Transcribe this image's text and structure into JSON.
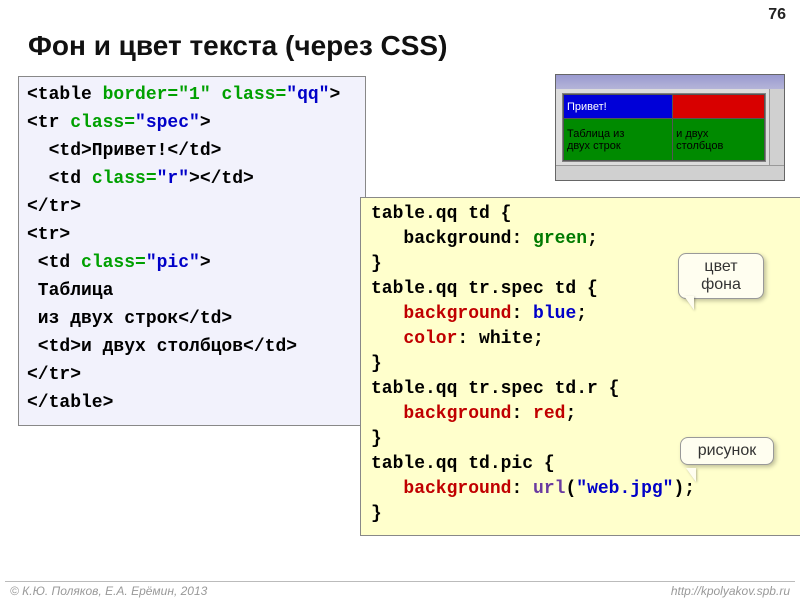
{
  "page_number": "76",
  "title": "Фон и цвет текста (через CSS)",
  "html_code": {
    "l1a": "<table ",
    "l1b": "border=\"1\"",
    "l1c": " class=",
    "l1d": "\"qq\"",
    "l1e": ">",
    "l2a": "<tr ",
    "l2b": "class=",
    "l2c": "\"spec\"",
    "l2d": ">",
    "l3": "  <td>Привет!</td>",
    "l4a": "  <td ",
    "l4b": "class=",
    "l4c": "\"r\"",
    "l4d": "></td>",
    "l5": "</tr>",
    "l6": "<tr>",
    "l7a": " <td ",
    "l7b": "class=",
    "l7c": "\"pic\"",
    "l7d": ">",
    "l8": " Таблица",
    "l9": " из двух строк</td>",
    "l10": " <td>и двух столбцов</td>",
    "l11": "</tr>",
    "l12": "</table>"
  },
  "css_code": {
    "r1": "table.qq td {",
    "r2a": "   ",
    "r2b": "background",
    "r2c": ": ",
    "r2d": "green",
    "r2e": ";",
    "r3": "}",
    "r4": "table.qq tr.spec td {",
    "r5a": "   ",
    "r5b": "background",
    "r5c": ": ",
    "r5d": "blue",
    "r5e": ";",
    "r6a": "   ",
    "r6b": "color",
    "r6c": ": white;",
    "r7": "}",
    "r8": "table.qq tr.spec td.r {",
    "r9a": "   ",
    "r9b": "background",
    "r9c": ": ",
    "r9d": "red",
    "r9e": ";",
    "r10": "}",
    "r11": "table.qq td.pic {",
    "r12a": "   ",
    "r12b": "background",
    "r12c": ": ",
    "r12d": "url",
    "r12e": "(",
    "r12f": "\"web.jpg\"",
    "r12g": ");",
    "r13": "}"
  },
  "preview": {
    "cell1": "Привет!",
    "cell2": "",
    "cell3": "Таблица из\nдвух строк",
    "cell4": "и двух\nстолбцов"
  },
  "callout1_line1": "цвет",
  "callout1_line2": "фона",
  "callout2": "рисунок",
  "footer_left": "© К.Ю. Поляков, Е.А. Ерёмин, 2013",
  "footer_right": "http://kpolyakov.spb.ru"
}
